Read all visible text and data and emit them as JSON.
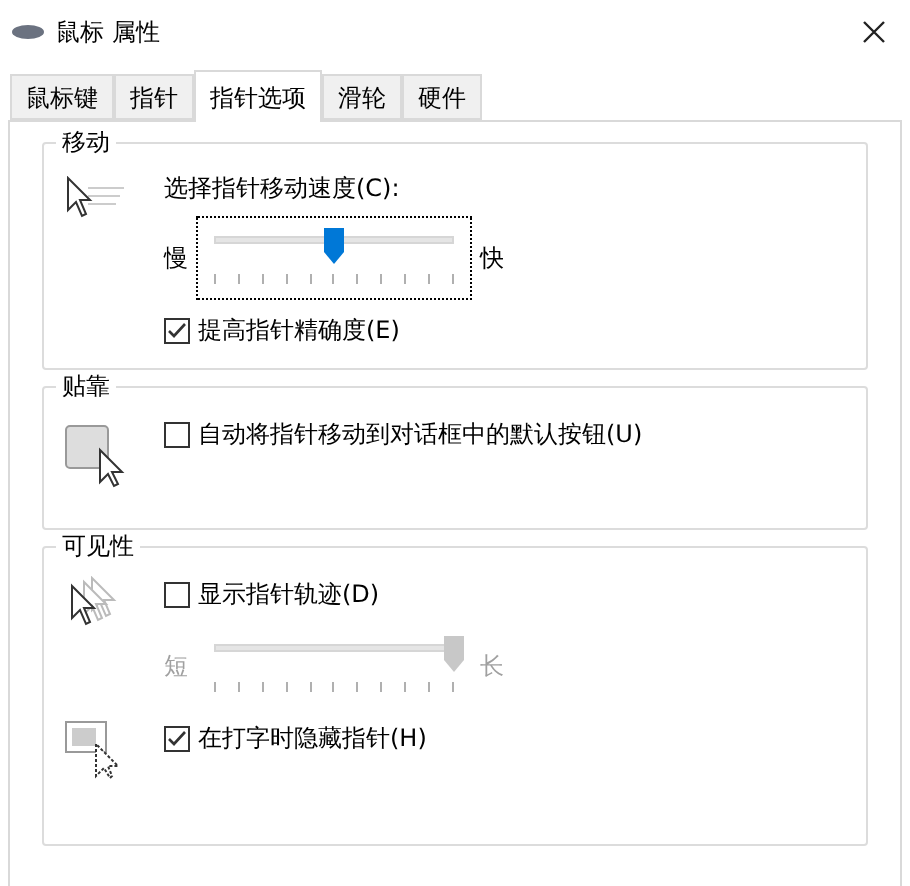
{
  "window": {
    "title": "鼠标 属性"
  },
  "tabs": [
    {
      "label": "鼠标键",
      "selected": false
    },
    {
      "label": "指针",
      "selected": false
    },
    {
      "label": "指针选项",
      "selected": true
    },
    {
      "label": "滑轮",
      "selected": false
    },
    {
      "label": "硬件",
      "selected": false
    }
  ],
  "groups": [
    {
      "title": "移动",
      "rows": [
        {
          "kind": "label",
          "text": "选择指针移动速度(C):"
        },
        {
          "kind": "slider",
          "min_label": "慢",
          "max_label": "快",
          "level": 0.5,
          "disabled": false,
          "focused": true
        },
        {
          "kind": "checkbox",
          "label": "提高指针精确度(E)",
          "checked": true
        }
      ]
    },
    {
      "title": "贴靠",
      "rows": [
        {
          "kind": "checkbox",
          "label": "自动将指针移动到对话框中的默认按钮(U)",
          "checked": false
        }
      ]
    },
    {
      "title": "可见性",
      "rows": [
        {
          "kind": "checkbox",
          "label": "显示指针轨迹(D)",
          "checked": false
        },
        {
          "kind": "slider",
          "min_label": "短",
          "max_label": "长",
          "level": 1,
          "disabled": true,
          "focused": false
        },
        {
          "kind": "checkbox",
          "label": "在打字时隐藏指针(H)",
          "checked": true
        }
      ]
    }
  ]
}
